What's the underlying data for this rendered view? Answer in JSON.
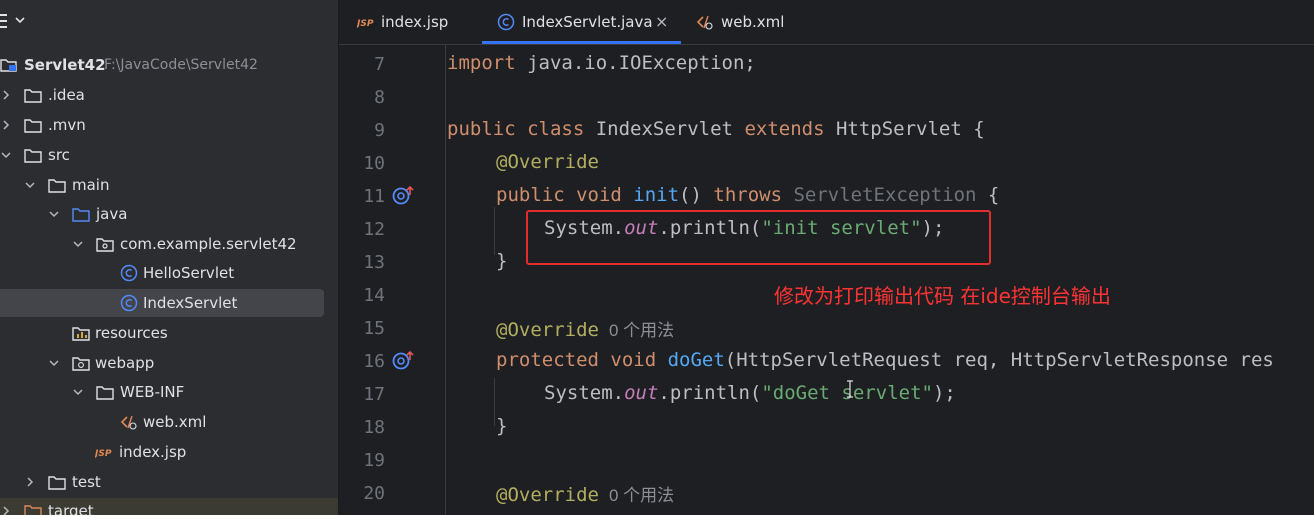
{
  "colors": {
    "accent": "#3574f0",
    "keyword": "#cf8e6d",
    "annotation": "#b3ae60",
    "function": "#56a8f5",
    "string": "#6aab73",
    "field": "#c77dbb",
    "highlight_box": "#e32d2d",
    "note_text": "#ff3333"
  },
  "project": {
    "header_icon": "project-view-icon",
    "tree": [
      {
        "label": "Servlet42",
        "path": "F:\\JavaCode\\Servlet42",
        "icon": "module-folder-icon"
      },
      {
        "label": ".idea",
        "icon": "folder-icon"
      },
      {
        "label": ".mvn",
        "icon": "folder-icon"
      },
      {
        "label": "src",
        "icon": "folder-icon"
      },
      {
        "label": "main",
        "icon": "folder-icon"
      },
      {
        "label": "java",
        "icon": "source-folder-icon"
      },
      {
        "label": "com.example.servlet42",
        "icon": "package-icon"
      },
      {
        "label": "HelloServlet",
        "icon": "java-class-icon"
      },
      {
        "label": "IndexServlet",
        "icon": "java-class-icon"
      },
      {
        "label": "resources",
        "icon": "resources-folder-icon"
      },
      {
        "label": "webapp",
        "icon": "web-folder-icon"
      },
      {
        "label": "WEB-INF",
        "icon": "folder-icon"
      },
      {
        "label": "web.xml",
        "icon": "xml-file-icon"
      },
      {
        "label": "index.jsp",
        "icon": "jsp-file-icon"
      },
      {
        "label": "test",
        "icon": "folder-icon"
      },
      {
        "label": "target",
        "icon": "excluded-folder-icon"
      }
    ]
  },
  "tabs": [
    {
      "label": "index.jsp",
      "icon": "jsp-file-icon"
    },
    {
      "label": "IndexServlet.java",
      "icon": "java-class-icon",
      "active": true,
      "close": "×"
    },
    {
      "label": "web.xml",
      "icon": "xml-file-icon"
    }
  ],
  "editor": {
    "lines": [
      {
        "num": "7"
      },
      {
        "num": "8"
      },
      {
        "num": "9"
      },
      {
        "num": "10"
      },
      {
        "num": "11",
        "gutter_icon": "implements-method-icon"
      },
      {
        "num": "12"
      },
      {
        "num": "13"
      },
      {
        "num": "14"
      },
      {
        "num": "15"
      },
      {
        "num": "16",
        "gutter_icon": "implements-method-icon"
      },
      {
        "num": "17"
      },
      {
        "num": "18"
      },
      {
        "num": "19"
      },
      {
        "num": "20"
      }
    ],
    "tokens": {
      "l7_import": "import",
      "l7_rest": " java.io.IOException;",
      "l9_public": "public",
      "l9_class": " class",
      "l9_name": " IndexServlet",
      "l9_extends": " extends",
      "l9_rest": " HttpServlet {",
      "l10_ann": "@Override",
      "l11_public": "public",
      "l11_void": " void",
      "l11_init": " init",
      "l11_paren": "()",
      "l11_throws": " throws",
      "l11_exc": " ServletException",
      "l11_brace": " {",
      "l12_sys": "System.",
      "l12_out": "out",
      "l12_print": ".println(",
      "l12_str": "\"init servlet\"",
      "l12_end": ");",
      "l13_brace": "}",
      "l15_ann": "@Override",
      "l15_hint": "0 个用法",
      "l16_protected": "protected",
      "l16_void": " void",
      "l16_doget": " doGet",
      "l16_rest": "(HttpServletRequest req, HttpServletResponse res",
      "l17_sys": "System.",
      "l17_out": "out",
      "l17_print": ".println(",
      "l17_str": "\"doGet servlet\"",
      "l17_end": ");",
      "l18_brace": "}",
      "l20_ann": "@Override",
      "l20_hint": "0 个用法"
    },
    "annotation_note": "修改为打印输出代码   在ide控制台输出"
  }
}
